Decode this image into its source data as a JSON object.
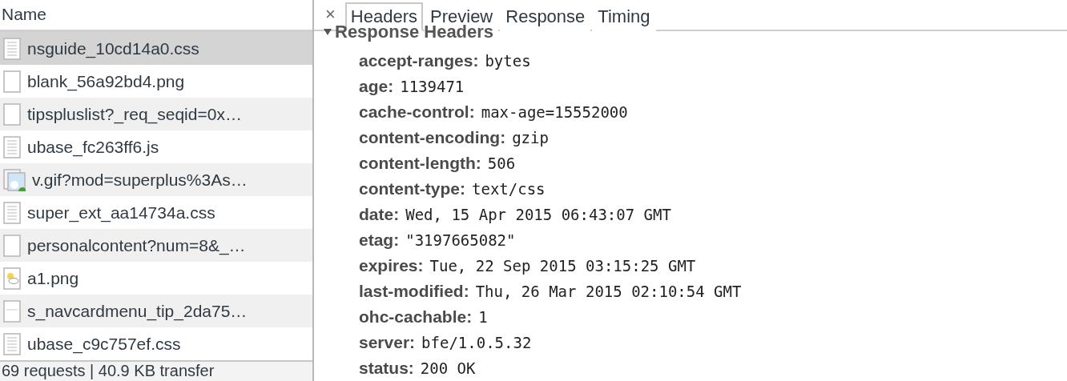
{
  "requests": {
    "column": "Name",
    "rows": [
      {
        "name": "nsguide_10cd14a0.css",
        "kind": "doc",
        "selected": true
      },
      {
        "name": "blank_56a92bd4.png",
        "kind": "blank",
        "selected": false
      },
      {
        "name": "tipspluslist?_req_seqid=0x…",
        "kind": "blank",
        "selected": false
      },
      {
        "name": "ubase_fc263ff6.js",
        "kind": "doc",
        "selected": false
      },
      {
        "name": "v.gif?mod=superplus%3As…",
        "kind": "image",
        "selected": false
      },
      {
        "name": "super_ext_aa14734a.css",
        "kind": "doc",
        "selected": false
      },
      {
        "name": "personalcontent?num=8&_…",
        "kind": "blank",
        "selected": false
      },
      {
        "name": "a1.png",
        "kind": "sun",
        "selected": false
      },
      {
        "name": "s_navcardmenu_tip_2da75…",
        "kind": "line",
        "selected": false
      },
      {
        "name": "ubase_c9c757ef.css",
        "kind": "doc",
        "selected": false
      }
    ],
    "status_bar": "69 requests | 40.9 KB transfer"
  },
  "details": {
    "close": "×",
    "tabs": [
      {
        "label": "Headers",
        "selected": true
      },
      {
        "label": "Preview",
        "selected": false
      },
      {
        "label": "Response",
        "selected": false
      },
      {
        "label": "Timing",
        "selected": false
      }
    ],
    "section": {
      "title": "Response Headers",
      "expanded": true
    },
    "headers": [
      {
        "key": "accept-ranges:",
        "value": "bytes"
      },
      {
        "key": "age:",
        "value": "1139471"
      },
      {
        "key": "cache-control:",
        "value": "max-age=15552000"
      },
      {
        "key": "content-encoding:",
        "value": "gzip"
      },
      {
        "key": "content-length:",
        "value": "506"
      },
      {
        "key": "content-type:",
        "value": "text/css"
      },
      {
        "key": "date:",
        "value": "Wed, 15 Apr 2015 06:43:07 GMT"
      },
      {
        "key": "etag:",
        "value": "\"3197665082\""
      },
      {
        "key": "expires:",
        "value": "Tue, 22 Sep 2015 03:15:25 GMT"
      },
      {
        "key": "last-modified:",
        "value": "Thu, 26 Mar 2015 02:10:54 GMT"
      },
      {
        "key": "ohc-cachable:",
        "value": "1"
      },
      {
        "key": "server:",
        "value": "bfe/1.0.5.32"
      },
      {
        "key": "status:",
        "value": "200 OK"
      }
    ]
  }
}
